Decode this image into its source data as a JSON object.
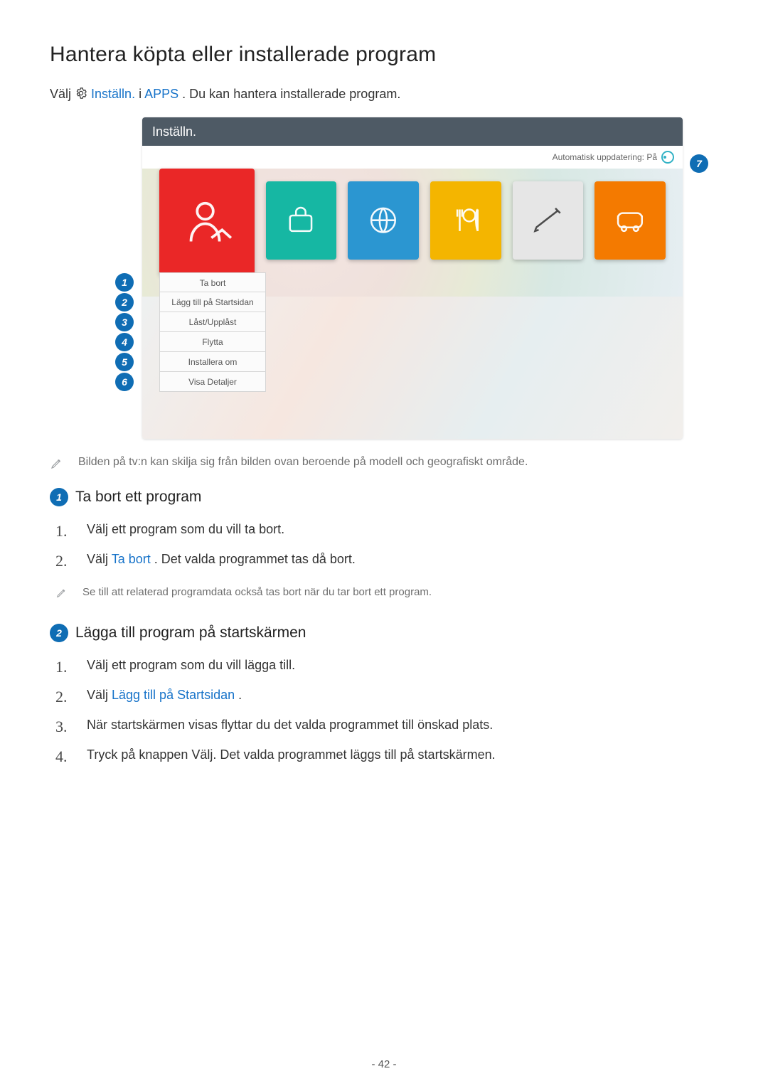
{
  "page_number_label": "- 42 -",
  "H1": "Hantera köpta eller installerade program",
  "intro": {
    "valj": "Välj ",
    "installn": "Inställn.",
    "mid": " i ",
    "apps": "APPS",
    "tail": ". Du kan hantera installerade program."
  },
  "tv": {
    "header": "Inställn.",
    "auto_update_label": "Automatisk uppdatering: På",
    "bubble7": "7",
    "menu": {
      "b1": "1",
      "m1": "Ta bort",
      "b2": "2",
      "m2": "Lägg till på Startsidan",
      "b3": "3",
      "m3": "Låst/Upplåst",
      "b4": "4",
      "m4": "Flytta",
      "b5": "5",
      "m5": "Installera om",
      "b6": "6",
      "m6": "Visa Detaljer"
    }
  },
  "note1": "Bilden på tv:n kan skilja sig från bilden ovan beroende på modell och geografiskt område.",
  "section1": {
    "num": "1",
    "title": "Ta bort ett program",
    "step1_num": "1.",
    "step1_text": "Välj ett program som du vill ta bort.",
    "step2_num": "2.",
    "step2_pre": "Välj ",
    "step2_link": "Ta bort",
    "step2_post": ". Det valda programmet tas då bort.",
    "note": "Se till att relaterad programdata också tas bort när du tar bort ett program."
  },
  "section2": {
    "num": "2",
    "title": "Lägga till program på startskärmen",
    "step1_num": "1.",
    "step1_text": "Välj ett program som du vill lägga till.",
    "step2_num": "2.",
    "step2_pre": "Välj ",
    "step2_link": "Lägg till på Startsidan",
    "step2_post": ".",
    "step3_num": "3.",
    "step3_text": "När startskärmen visas flyttar du det valda programmet till önskad plats.",
    "step4_num": "4.",
    "step4_text": "Tryck på knappen Välj. Det valda programmet läggs till på startskärmen."
  }
}
